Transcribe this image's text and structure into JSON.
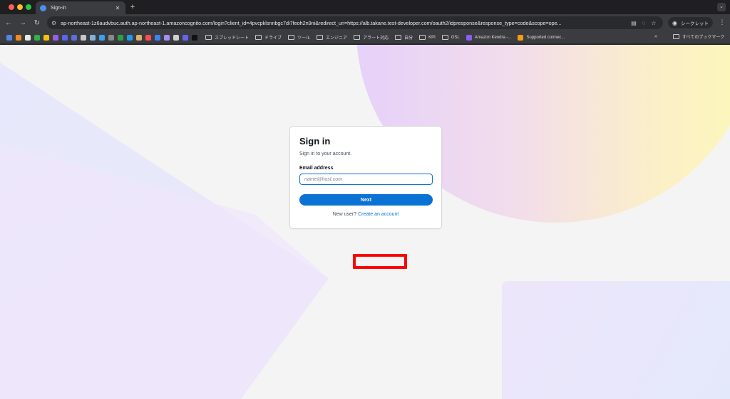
{
  "browser": {
    "tab_title": "Sign-in",
    "url": "ap-northeast-1z6audvbuc.auth.ap-northeast-1.amazoncognito.com/login?client_id=4pvcpklsnnbgc7di7feoh2n9ni&redirect_uri=https://alb.takane.test-developer.com/oauth2/idpresponse&response_type=code&scope=ope...",
    "incognito_label": "シークレット",
    "bookmarks": [
      "スプレッドシート",
      "ドライブ",
      "ツール",
      "エンジニア",
      "アラート対応",
      "自分",
      "KPI",
      "GSL",
      "Amazon Kendra -...",
      "Supported connec..."
    ],
    "all_bookmarks_label": "すべてのブックマーク"
  },
  "signin": {
    "title": "Sign in",
    "subtitle": "Sign in to your account.",
    "email_label": "Email address",
    "email_placeholder": "name@host.com",
    "next_label": "Next",
    "new_user_text": "New user?",
    "create_account_label": "Create an account"
  },
  "colors": {
    "primary": "#0972d3",
    "highlight": "#ff0000"
  }
}
